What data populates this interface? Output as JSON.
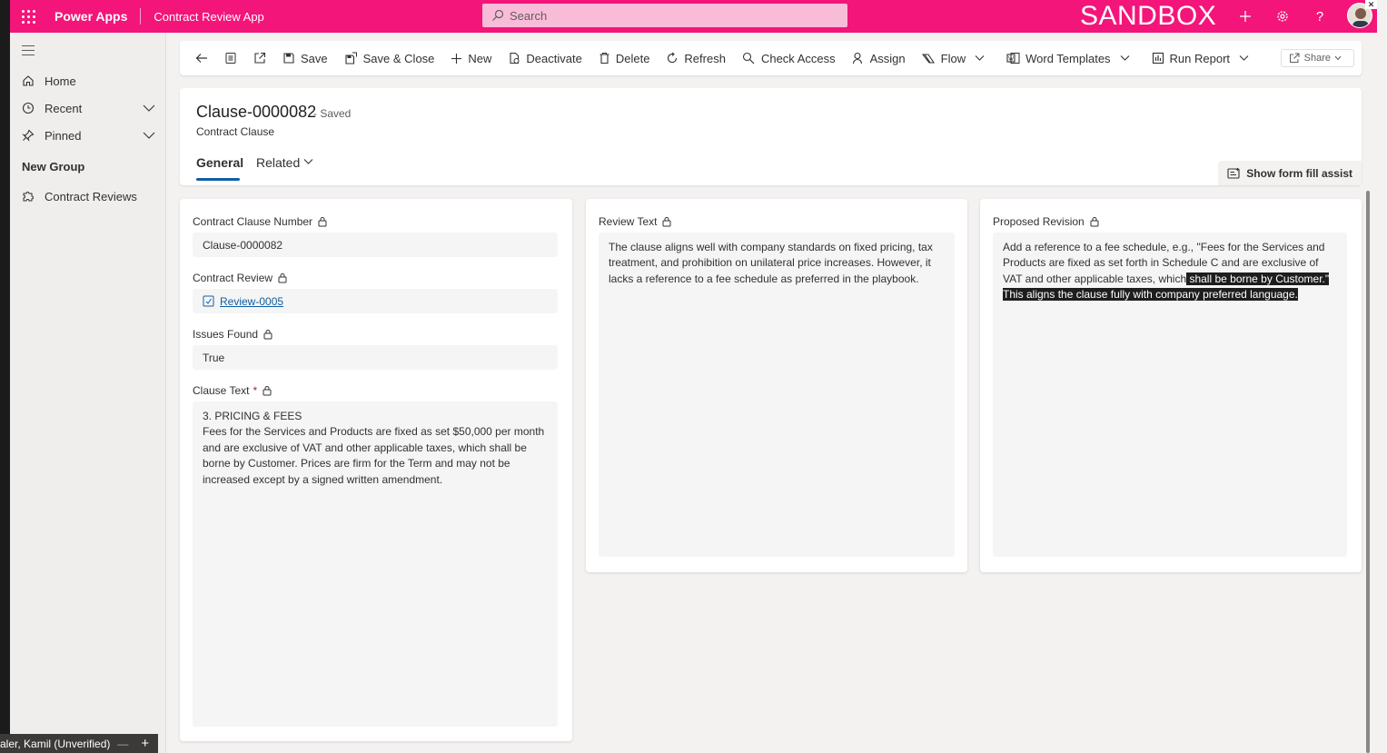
{
  "topbar": {
    "brand": "Power Apps",
    "app_name": "Contract Review App",
    "search_placeholder": "Search",
    "environment_label": "SANDBOX"
  },
  "sidebar": {
    "items": [
      {
        "label": "Home",
        "icon": "home-icon"
      },
      {
        "label": "Recent",
        "icon": "clock-icon"
      },
      {
        "label": "Pinned",
        "icon": "pin-icon"
      }
    ],
    "group_label": "New Group",
    "group_items": [
      {
        "label": "Contract Reviews",
        "icon": "puzzle-icon"
      }
    ],
    "user_label": "aler, Kamil (Unverified)"
  },
  "commandbar": {
    "save": "Save",
    "save_close": "Save & Close",
    "new": "New",
    "deactivate": "Deactivate",
    "delete": "Delete",
    "refresh": "Refresh",
    "check_access": "Check Access",
    "assign": "Assign",
    "flow": "Flow",
    "word_templates": "Word Templates",
    "run_report": "Run Report",
    "share": "Share"
  },
  "record": {
    "title": "Clause-0000082",
    "status": "- Saved",
    "entity": "Contract Clause",
    "tabs": [
      "General",
      "Related"
    ],
    "fill_assist": "Show form fill assist"
  },
  "form": {
    "clause_number_label": "Contract Clause Number",
    "clause_number_value": "Clause-0000082",
    "review_label": "Contract Review",
    "review_value": "Review-0005",
    "issues_label": "Issues Found",
    "issues_value": "True",
    "clause_text_label": "Clause Text",
    "clause_text_required": "*",
    "clause_text_heading": "3. PRICING & FEES",
    "clause_text_body": "Fees for the Services and Products are fixed as set $50,000 per month and are exclusive of VAT and other applicable taxes, which shall be borne by Customer. Prices are firm for the Term and may not be increased except by a signed written amendment.",
    "review_text_label": "Review Text",
    "review_text_value": "The clause aligns well with company standards on fixed pricing, tax treatment, and prohibition on unilateral price increases. However, it lacks a reference to a fee schedule as preferred in the playbook.",
    "proposed_label": "Proposed Revision",
    "proposed_value_plain": "Add a reference to a fee schedule, e.g., \"Fees for the Services and Products are fixed as set forth in Schedule C and are exclusive of VAT and other applicable taxes, which",
    "proposed_value_selected": " shall be borne by Customer.\" This aligns the clause fully with company preferred language."
  },
  "colors": {
    "topbar": "#f3157a",
    "accent": "#115ea3",
    "selection": "#1e1e1e"
  }
}
